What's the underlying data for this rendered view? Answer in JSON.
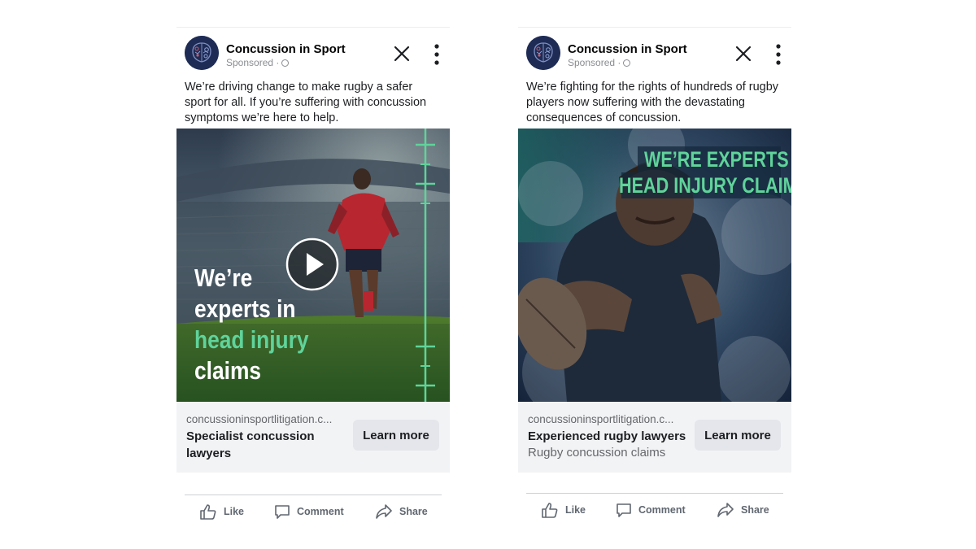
{
  "ads": [
    {
      "page_name": "Concussion in Sport",
      "sponsored": "Sponsored ·",
      "caption": "We’re driving change to make rugby a safer sport for all. If you’re suffering with concussion symptoms we’re here to help.",
      "overlay": {
        "line1": "We’re",
        "line2": "experts in",
        "line3": "head injury",
        "line4": "claims"
      },
      "domain": "concussioninsportlitigation.c...",
      "headline": "Specialist concussion lawyers",
      "cta": "Learn more",
      "actions": {
        "like": "Like",
        "comment": "Comment",
        "share": "Share"
      }
    },
    {
      "page_name": "Concussion in Sport",
      "sponsored": "Sponsored ·",
      "caption": "We’re fighting for the rights of hundreds of rugby players now suffering with the devastating consequences of concussion.",
      "overlay": {
        "line1": "WE’RE EXPERTS IN",
        "line2": "HEAD INJURY CLAIMS"
      },
      "domain": "concussioninsportlitigation.c...",
      "headline": "Experienced rugby lawyers",
      "description": "Rugby concussion claims",
      "cta": "Learn more",
      "actions": {
        "like": "Like",
        "comment": "Comment",
        "share": "Share"
      }
    }
  ],
  "colors": {
    "brand_navy": "#1e2c55",
    "accent_green": "#5fd39a",
    "button_grey": "#e4e6eb"
  }
}
